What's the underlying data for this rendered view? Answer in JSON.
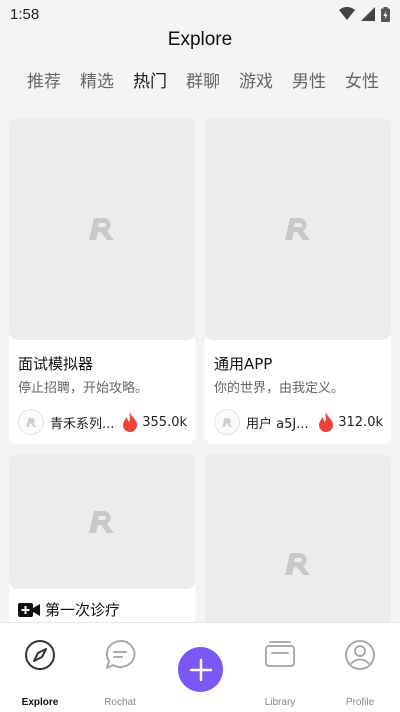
{
  "status": {
    "time": "1:58"
  },
  "header": {
    "title": "Explore"
  },
  "tabs": [
    {
      "label": "推荐",
      "active": false
    },
    {
      "label": "精选",
      "active": false
    },
    {
      "label": "热门",
      "active": true
    },
    {
      "label": "群聊",
      "active": false
    },
    {
      "label": "游戏",
      "active": false
    },
    {
      "label": "男性",
      "active": false
    },
    {
      "label": "女性",
      "active": false
    }
  ],
  "cards": [
    {
      "title": "面试模拟器",
      "description": "停止招聘，开始攻略。",
      "author": "青禾系列...",
      "heat": "355.0k"
    },
    {
      "title": "通用APP",
      "description": "你的世界，由我定义。",
      "author": "用户 a5J...",
      "heat": "312.0k"
    },
    {
      "title": "第一次诊疗",
      "description": "",
      "author": "",
      "heat": ""
    },
    {
      "title": "",
      "description": "",
      "author": "",
      "heat": ""
    }
  ],
  "bottom_nav": {
    "explore": "Explore",
    "rochat": "Rochat",
    "library": "Library",
    "profile": "Profile"
  },
  "colors": {
    "accent": "#7b57f6",
    "fire": "#f0433a"
  }
}
